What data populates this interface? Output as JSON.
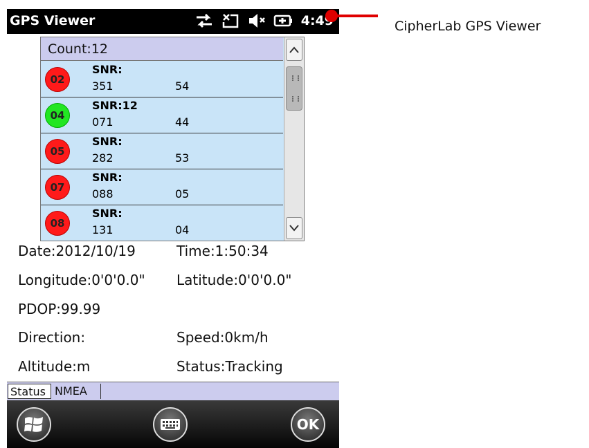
{
  "statusbar": {
    "title": "GPS Viewer",
    "icons": [
      "data-transfer-icon",
      "no-signal-icon",
      "volume-muted-icon",
      "battery-charging-icon"
    ],
    "time": "4:49"
  },
  "satellites": {
    "count_label": "Count:12",
    "rows": [
      {
        "id": "02",
        "snr": "SNR:",
        "v1": "351",
        "v2": "54",
        "color": "#ff1a1a"
      },
      {
        "id": "04",
        "snr": "SNR:12",
        "v1": "071",
        "v2": "44",
        "color": "#22e622"
      },
      {
        "id": "05",
        "snr": "SNR:",
        "v1": "282",
        "v2": "53",
        "color": "#ff1a1a"
      },
      {
        "id": "07",
        "snr": "SNR:",
        "v1": "088",
        "v2": "05",
        "color": "#ff1a1a"
      },
      {
        "id": "08",
        "snr": "SNR:",
        "v1": "131",
        "v2": "04",
        "color": "#ff1a1a"
      }
    ]
  },
  "info": {
    "date": "Date:2012/10/19",
    "time": "Time:1:50:34",
    "longitude": "Longitude:0'0'0.0\"",
    "latitude": "Latitude:0'0'0.0\"",
    "pdop": "PDOP:99.99",
    "direction": "Direction:",
    "speed": "Speed:0km/h",
    "altitude": "Altitude:m",
    "status": "Status:Tracking"
  },
  "tabs": {
    "status": "Status",
    "nmea": "NMEA"
  },
  "softkeys": {
    "start": "windows-start-icon",
    "keyboard": "keyboard-icon",
    "ok": "OK"
  },
  "annotation": {
    "label": "CipherLab GPS Viewer",
    "color": "#e00000"
  }
}
